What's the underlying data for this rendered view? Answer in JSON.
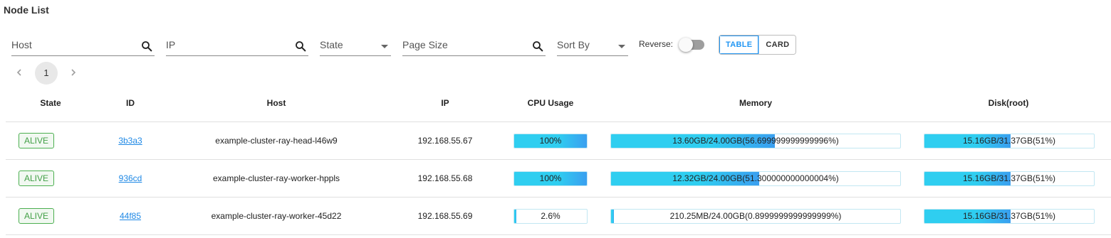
{
  "page": {
    "title": "Node List"
  },
  "filters": {
    "host_label": "Host",
    "ip_label": "IP",
    "state_label": "State",
    "page_size_label": "Page Size",
    "sort_by_label": "Sort By",
    "reverse_label": "Reverse:",
    "reverse_on": false
  },
  "view_toggle": {
    "table_label": "TABLE",
    "card_label": "CARD",
    "active": "TABLE"
  },
  "pagination": {
    "current_page": "1"
  },
  "colors": {
    "alive": "#43a047",
    "link": "#1e88e5",
    "bar": "#2fcef0",
    "bar_end": "#3a9ff0"
  },
  "table": {
    "headers": [
      "State",
      "ID",
      "Host",
      "IP",
      "CPU Usage",
      "Memory",
      "Disk(root)"
    ],
    "rows": [
      {
        "state": "ALIVE",
        "id": "3b3a3",
        "host": "example-cluster-ray-head-l46w9",
        "ip": "192.168.55.67",
        "cpu": {
          "text": "100%",
          "fraction": 1.0
        },
        "memory": {
          "text": "13.60GB/24.00GB(56.699999999999996%)",
          "fraction": 0.567
        },
        "disk": {
          "text": "15.16GB/31.37GB(51%)",
          "fraction": 0.51
        }
      },
      {
        "state": "ALIVE",
        "id": "936cd",
        "host": "example-cluster-ray-worker-hppls",
        "ip": "192.168.55.68",
        "cpu": {
          "text": "100%",
          "fraction": 1.0
        },
        "memory": {
          "text": "12.32GB/24.00GB(51.300000000000004%)",
          "fraction": 0.513
        },
        "disk": {
          "text": "15.16GB/31.37GB(51%)",
          "fraction": 0.51
        }
      },
      {
        "state": "ALIVE",
        "id": "44f85",
        "host": "example-cluster-ray-worker-45d22",
        "ip": "192.168.55.69",
        "cpu": {
          "text": "2.6%",
          "fraction": 0.026
        },
        "memory": {
          "text": "210.25MB/24.00GB(0.8999999999999999%)",
          "fraction": 0.009
        },
        "disk": {
          "text": "15.16GB/31.37GB(51%)",
          "fraction": 0.51
        }
      }
    ]
  }
}
